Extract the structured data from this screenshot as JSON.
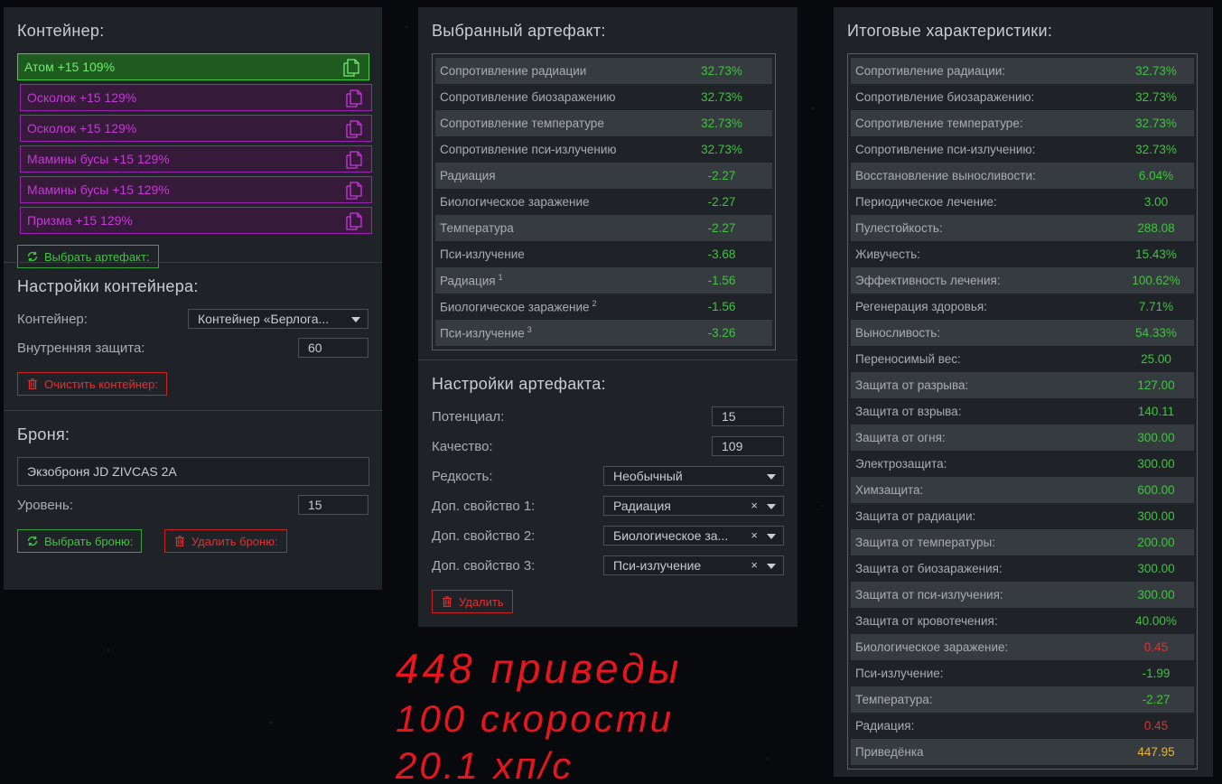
{
  "container_panel": {
    "title": "Контейнер:",
    "slots": [
      {
        "label": "Атом +15 109%",
        "color": "green"
      },
      {
        "label": "Осколок +15 129%",
        "color": "purple"
      },
      {
        "label": "Осколок +15 129%",
        "color": "purple"
      },
      {
        "label": "Мамины бусы +15 129%",
        "color": "purple"
      },
      {
        "label": "Мамины бусы +15 129%",
        "color": "purple"
      },
      {
        "label": "Призма +15 129%",
        "color": "purple"
      }
    ],
    "choose_artifact_label": "Выбрать артефакт:",
    "settings_title": "Настройки контейнера:",
    "container_label": "Контейнер:",
    "container_value": "Контейнер «Берлога...",
    "inner_protection_label": "Внутренняя защита:",
    "inner_protection_value": "60",
    "clear_label": "Очистить контейнер:",
    "armor_title": "Броня:",
    "armor_value": "Экзоброня JD ZIVCAS 2A",
    "level_label": "Уровень:",
    "level_value": "15",
    "choose_armor_label": "Выбрать броню:",
    "delete_armor_label": "Удалить броню:"
  },
  "artifact_panel": {
    "title": "Выбранный артефакт:",
    "stats": [
      {
        "name": "Сопротивление радиации",
        "value": "32.73%",
        "color": "green",
        "sup": ""
      },
      {
        "name": "Сопротивление биозаражению",
        "value": "32.73%",
        "color": "green",
        "sup": ""
      },
      {
        "name": "Сопротивление температуре",
        "value": "32.73%",
        "color": "green",
        "sup": ""
      },
      {
        "name": "Сопротивление пси-излучению",
        "value": "32.73%",
        "color": "green",
        "sup": ""
      },
      {
        "name": "Радиация",
        "value": "-2.27",
        "color": "green",
        "sup": ""
      },
      {
        "name": "Биологическое заражение",
        "value": "-2.27",
        "color": "green",
        "sup": ""
      },
      {
        "name": "Температура",
        "value": "-2.27",
        "color": "green",
        "sup": ""
      },
      {
        "name": "Пси-излучение",
        "value": "-3.68",
        "color": "green",
        "sup": ""
      },
      {
        "name": "Радиация",
        "value": "-1.56",
        "color": "green",
        "sup": "1"
      },
      {
        "name": "Биологическое заражение",
        "value": "-1.56",
        "color": "green",
        "sup": "2"
      },
      {
        "name": "Пси-излучение",
        "value": "-3.26",
        "color": "green",
        "sup": "3"
      }
    ],
    "settings_title": "Настройки артефакта:",
    "potential_label": "Потенциал:",
    "potential_value": "15",
    "quality_label": "Качество:",
    "quality_value": "109",
    "rarity_label": "Редкость:",
    "rarity_value": "Необычный",
    "extra1_label": "Доп. свойство 1:",
    "extra1_value": "Радиация",
    "extra2_label": "Доп. свойство 2:",
    "extra2_value": "Биологическое за...",
    "extra3_label": "Доп. свойство 3:",
    "extra3_value": "Пси-излучение",
    "clear_x": "×",
    "delete_label": "Удалить"
  },
  "totals_panel": {
    "title": "Итоговые характеристики:",
    "stats": [
      {
        "name": "Сопротивление радиации:",
        "value": "32.73%",
        "color": "green"
      },
      {
        "name": "Сопротивление биозаражению:",
        "value": "32.73%",
        "color": "green"
      },
      {
        "name": "Сопротивление температуре:",
        "value": "32.73%",
        "color": "green"
      },
      {
        "name": "Сопротивление пси-излучению:",
        "value": "32.73%",
        "color": "green"
      },
      {
        "name": "Восстановление выносливости:",
        "value": "6.04%",
        "color": "green"
      },
      {
        "name": "Периодическое лечение:",
        "value": "3.00",
        "color": "green"
      },
      {
        "name": "Пулестойкость:",
        "value": "288.08",
        "color": "green"
      },
      {
        "name": "Живучесть:",
        "value": "15.43%",
        "color": "green"
      },
      {
        "name": "Эффективность лечения:",
        "value": "100.62%",
        "color": "green"
      },
      {
        "name": "Регенерация здоровья:",
        "value": "7.71%",
        "color": "green"
      },
      {
        "name": "Выносливость:",
        "value": "54.33%",
        "color": "green"
      },
      {
        "name": "Переносимый вес:",
        "value": "25.00",
        "color": "green"
      },
      {
        "name": "Защита от разрыва:",
        "value": "127.00",
        "color": "green"
      },
      {
        "name": "Защита от взрыва:",
        "value": "140.11",
        "color": "green"
      },
      {
        "name": "Защита от огня:",
        "value": "300.00",
        "color": "green"
      },
      {
        "name": "Электрозащита:",
        "value": "300.00",
        "color": "green"
      },
      {
        "name": "Химзащита:",
        "value": "600.00",
        "color": "green"
      },
      {
        "name": "Защита от радиации:",
        "value": "300.00",
        "color": "green"
      },
      {
        "name": "Защита от температуры:",
        "value": "200.00",
        "color": "green"
      },
      {
        "name": "Защита от биозаражения:",
        "value": "300.00",
        "color": "green"
      },
      {
        "name": "Защита от пси-излучения:",
        "value": "300.00",
        "color": "green"
      },
      {
        "name": "Защита от кровотечения:",
        "value": "40.00%",
        "color": "green"
      },
      {
        "name": "Биологическое заражение:",
        "value": "0.45",
        "color": "red"
      },
      {
        "name": "Пси-излучение:",
        "value": "-1.99",
        "color": "green"
      },
      {
        "name": "Температура:",
        "value": "-2.27",
        "color": "green"
      },
      {
        "name": "Радиация:",
        "value": "0.45",
        "color": "red"
      },
      {
        "name": "Приведёнка",
        "value": "447.95",
        "color": "gold"
      }
    ]
  },
  "annotation": {
    "line1": "448 приведы",
    "line2": "100 скорости",
    "line3": "20.1 хп/с"
  },
  "colors": {
    "panel_bg": "#1f2327",
    "green": "#3ec43e",
    "red": "#e03030",
    "purple": "#c936d9",
    "gold": "#e8b436",
    "annotation_red": "#e8161c"
  }
}
